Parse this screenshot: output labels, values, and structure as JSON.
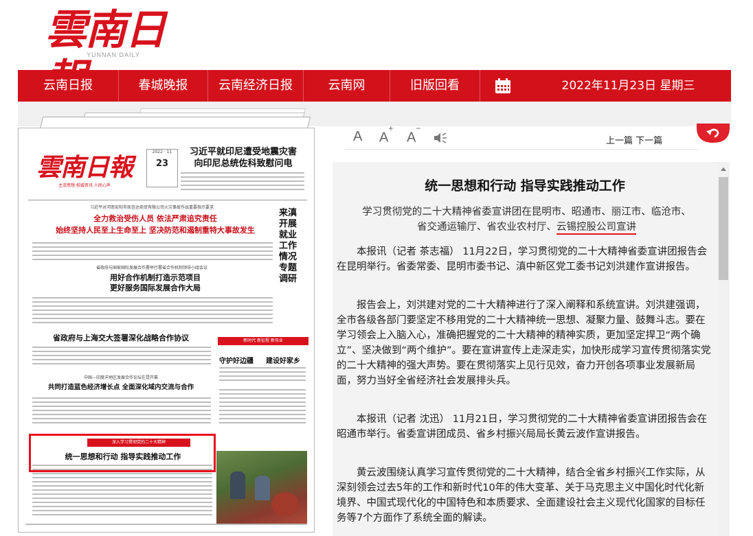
{
  "masthead": {
    "logo_cn": "雲南日報",
    "logo_en": "YUNNAN DAILY"
  },
  "nav": {
    "items": [
      "云南日报",
      "春城晚报",
      "云南经济日报",
      "云南网",
      "旧版回看"
    ],
    "calendar_icon": "calendar-icon",
    "date": "2022年11月23日 星期三"
  },
  "toolbar": {
    "font_normal": "A",
    "font_up": "A",
    "font_up_sign": "+",
    "font_down": "A",
    "font_down_sign": "−",
    "audio_icon": "speaker-icon",
    "prev": "上一篇",
    "next": "下一篇",
    "back_icon": "back-arrow-icon"
  },
  "thumbnail": {
    "logo": "雲南日報",
    "slogan": "主流思想  权威资讯  人民心声",
    "issue_no": "23",
    "issue_top": "2022 · 11",
    "headline_top": "习近平就印尼遭受地震灾害\n向印尼总统佐科致慰问电",
    "kicker1": "习近平对河南安阳市凯信达商贸有限公司火灾事故作出重要指示要求",
    "headline1": "全力救治受伤人员  依法严肃追究责任",
    "headline1b": "始终坚持人民至上生命至上  坚决防范和遏制重特大事故发生",
    "vertical": "来滇开展就业工作情况专题调研",
    "kicker2": "省政府与国家国际发展合作署举行署省合作机制领导小组会议",
    "headline2": "用好合作机制打造示范项目\n更好服务国际发展合作大局",
    "headline3": "省政府与上海交大签署深化战略合作协议",
    "redbox": "新时代  新征程  新伟业",
    "subhead_a": "守护好边疆",
    "subhead_b": "建设好家乡",
    "kicker4": "中国—印度洋地区发展合作论坛在昆开幕",
    "headline4": "共同打造蓝色经济增长点  全面深化域内交流与合作",
    "band": "深入学习贯彻党的二十大精神",
    "lead": "统一思想和行动  指导实践推动工作"
  },
  "article": {
    "title": "统一思想和行动 指导实践推动工作",
    "subtitle_line1": "学习贯彻党的二十大精神省委宣讲团在昆明市、昭通市、丽江市、临沧市、",
    "subtitle_line2a": "省交通运输厅、省农业农村厅、",
    "subtitle_line2b": "云锡控股公司宣讲",
    "paragraphs": [
      "本报讯（记者 茶志福） 11月22日，学习贯彻党的二十大精神省委宣讲团报告会在昆明举行。省委常委、昆明市委书记、滇中新区党工委书记刘洪建作宣讲报告。",
      "报告会上，刘洪建对党的二十大精神进行了深入阐释和系统宣讲。刘洪建强调，全市各级各部门要坚定不移用党的二十大精神统一思想、凝聚力量、鼓舞斗志。要在学习领会上入脑入心，准确把握党的二十大精神的精神实质，更加坚定捍卫“两个确立”、坚决做到“两个维护”。要在宣讲宣传上走深走实，加快形成学习宣传贯彻落实党的二十大精神的强大声势。要在贯彻落实上见行见效，奋力开创各项事业发展新局面，努力当好全省经济社会发展排头兵。",
      "本报讯（记者 沈迅） 11月21日，学习贯彻党的二十大精神省委宣讲团报告会在昭通市举行。省委宣讲团成员、省乡村振兴局局长黄云波作宣讲报告。",
      "黄云波围绕认真学习宣传贯彻党的二十大精神，结合全省乡村振兴工作实际，从深刻领会过去5年的工作和新时代10年的伟大变革、关于马克思主义中国化时代化新境界、中国式现代化的中国特色和本质要求、全面建设社会主义现代化国家的目标任务等7个方面作了系统全面的解读。"
    ]
  },
  "colors": {
    "brand_red": "#d3111b",
    "highlight_red": "#e8101c",
    "article_bg": "#f3f3f3"
  }
}
